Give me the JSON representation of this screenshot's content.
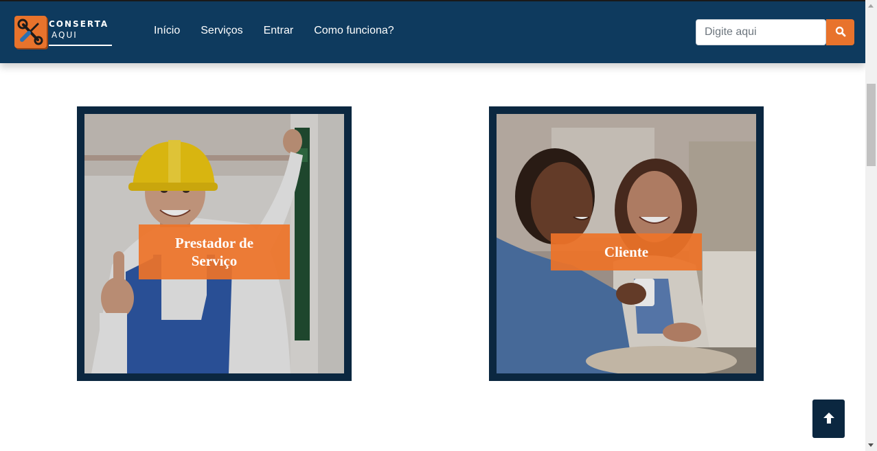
{
  "brand": {
    "line1": "CONSERTA",
    "line2": "AQUI",
    "logo_icon": "wrench-screwdriver-icon",
    "colors": {
      "navbar": "#0e3a5e",
      "accent": "#e8732c",
      "card_border": "#0b2740"
    }
  },
  "nav": {
    "items": [
      {
        "label": "Início"
      },
      {
        "label": "Serviços"
      },
      {
        "label": "Entrar"
      },
      {
        "label": "Como funciona?"
      }
    ]
  },
  "search": {
    "placeholder": "Digite aqui",
    "button_icon": "search-icon"
  },
  "cards": [
    {
      "label": "Prestador de Serviço",
      "image": "worker-thumbs-up-photo"
    },
    {
      "label": "Cliente",
      "image": "smiling-couple-photo"
    }
  ],
  "back_to_top": {
    "icon": "arrow-up-icon"
  }
}
